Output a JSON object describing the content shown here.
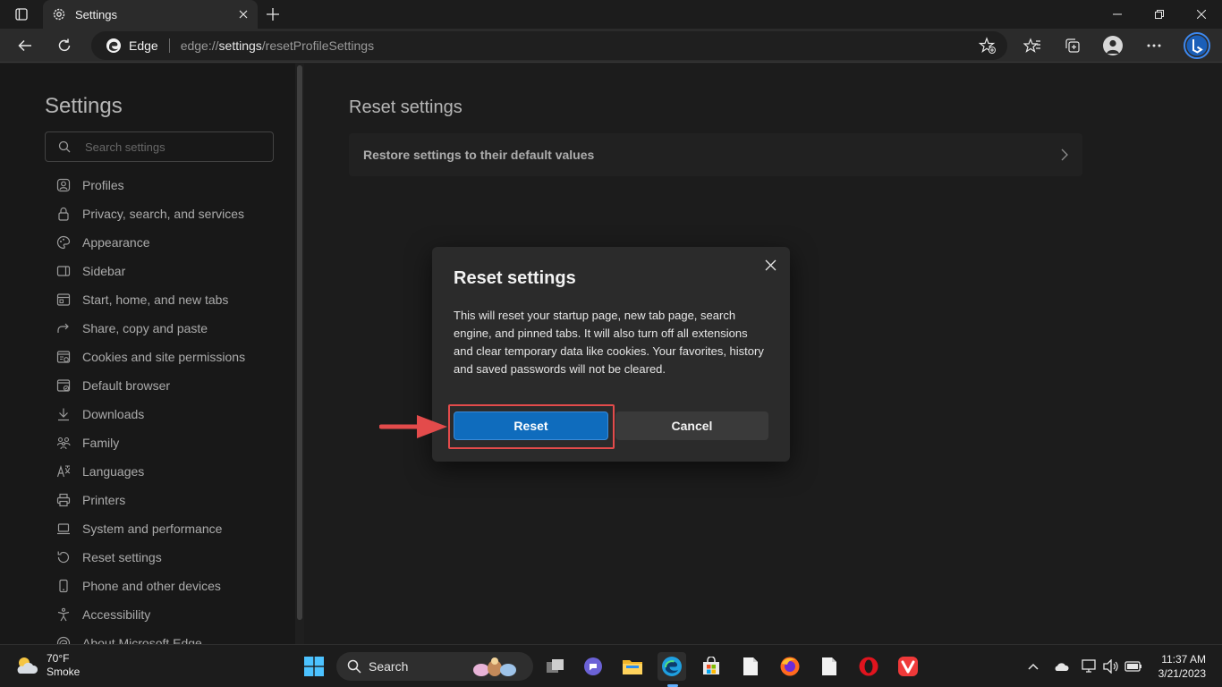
{
  "browser": {
    "tab_title": "Settings",
    "address_brand": "Edge",
    "url_prefix": "edge://",
    "url_host": "settings",
    "url_path": "/resetProfileSettings"
  },
  "sidebar": {
    "heading": "Settings",
    "search_placeholder": "Search settings",
    "items": [
      {
        "label": "Profiles",
        "icon": "profile-icon"
      },
      {
        "label": "Privacy, search, and services",
        "icon": "lock-icon"
      },
      {
        "label": "Appearance",
        "icon": "palette-icon"
      },
      {
        "label": "Sidebar",
        "icon": "sidebar-icon"
      },
      {
        "label": "Start, home, and new tabs",
        "icon": "home-icon"
      },
      {
        "label": "Share, copy and paste",
        "icon": "share-icon"
      },
      {
        "label": "Cookies and site permissions",
        "icon": "cookies-icon"
      },
      {
        "label": "Default browser",
        "icon": "browser-icon"
      },
      {
        "label": "Downloads",
        "icon": "download-icon"
      },
      {
        "label": "Family",
        "icon": "family-icon"
      },
      {
        "label": "Languages",
        "icon": "language-icon"
      },
      {
        "label": "Printers",
        "icon": "printer-icon"
      },
      {
        "label": "System and performance",
        "icon": "laptop-icon"
      },
      {
        "label": "Reset settings",
        "icon": "reset-icon"
      },
      {
        "label": "Phone and other devices",
        "icon": "phone-icon"
      },
      {
        "label": "Accessibility",
        "icon": "accessibility-icon"
      },
      {
        "label": "About Microsoft Edge",
        "icon": "edge-icon"
      }
    ]
  },
  "main": {
    "title": "Reset settings",
    "card_label": "Restore settings to their default values"
  },
  "dialog": {
    "title": "Reset settings",
    "body": "This will reset your startup page, new tab page, search engine, and pinned tabs. It will also turn off all extensions and clear temporary data like cookies. Your favorites, history and saved passwords will not be cleared.",
    "reset_label": "Reset",
    "cancel_label": "Cancel"
  },
  "taskbar": {
    "weather_temp": "70°F",
    "weather_desc": "Smoke",
    "search_label": "Search",
    "time": "11:37 AM",
    "date": "3/21/2023"
  },
  "colors": {
    "accent": "#0f6cbd",
    "highlight": "#e34b4b"
  }
}
